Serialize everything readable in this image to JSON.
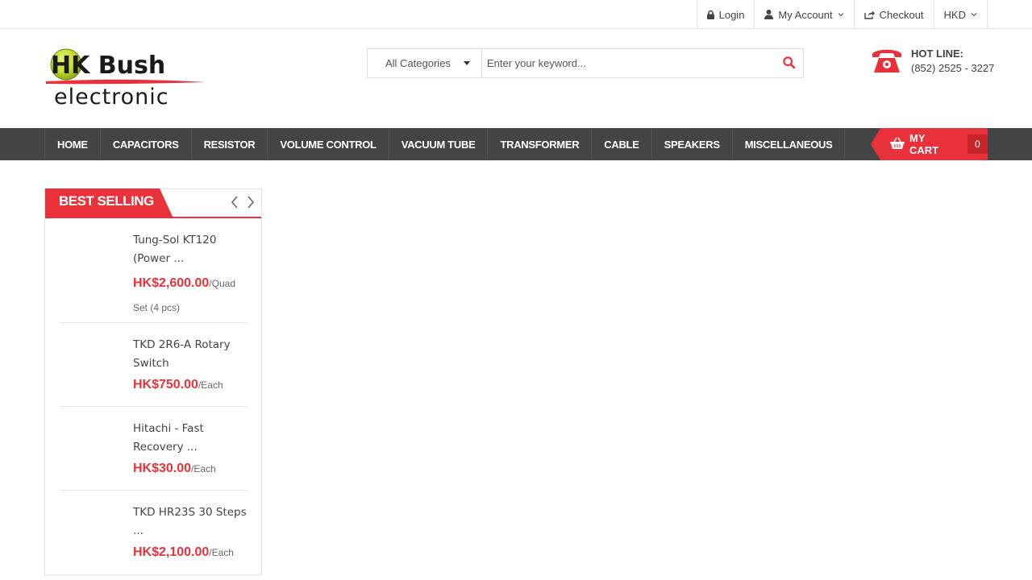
{
  "topbar": {
    "login": "Login",
    "account": "My Account",
    "checkout": "Checkout",
    "currency": "HKD"
  },
  "logo": {
    "name": "HK Bush",
    "sub": "electronic"
  },
  "search": {
    "category": "All Categories",
    "placeholder": "Enter your keyword..."
  },
  "hotline": {
    "label": "HOT LINE:",
    "number": "(852) 2525 - 3227"
  },
  "nav": {
    "items": [
      "HOME",
      "CAPACITORS",
      "RESISTOR",
      "VOLUME CONTROL",
      "VACUUM TUBE",
      "TRANSFORMER",
      "CABLE",
      "SPEAKERS",
      "MISCELLANEOUS"
    ]
  },
  "cart": {
    "label": "MY CART",
    "count": "0"
  },
  "best_selling": {
    "title": "BEST SELLING",
    "products": [
      {
        "name": "Tung-Sol KT120 (Power ...",
        "price": "HK$2,600.00",
        "unit": "/Quad Set (4 pcs)"
      },
      {
        "name": "TKD 2R6-A Rotary Switch",
        "price": "HK$750.00",
        "unit": "/Each"
      },
      {
        "name": "Hitachi - Fast Recovery ...",
        "price": "HK$30.00",
        "unit": "/Each"
      },
      {
        "name": "TKD HR23S 30 Steps ...",
        "price": "HK$2,100.00",
        "unit": "/Each"
      }
    ]
  },
  "colors": {
    "accent": "#e8313a",
    "nav_bg": "#444444",
    "logo_ball": "#c6dd2a"
  },
  "icons": {
    "login": "lock-icon",
    "account": "user-icon",
    "checkout": "share-icon",
    "search": "search-icon",
    "hotline": "telephone-icon",
    "cart": "basket-icon"
  }
}
